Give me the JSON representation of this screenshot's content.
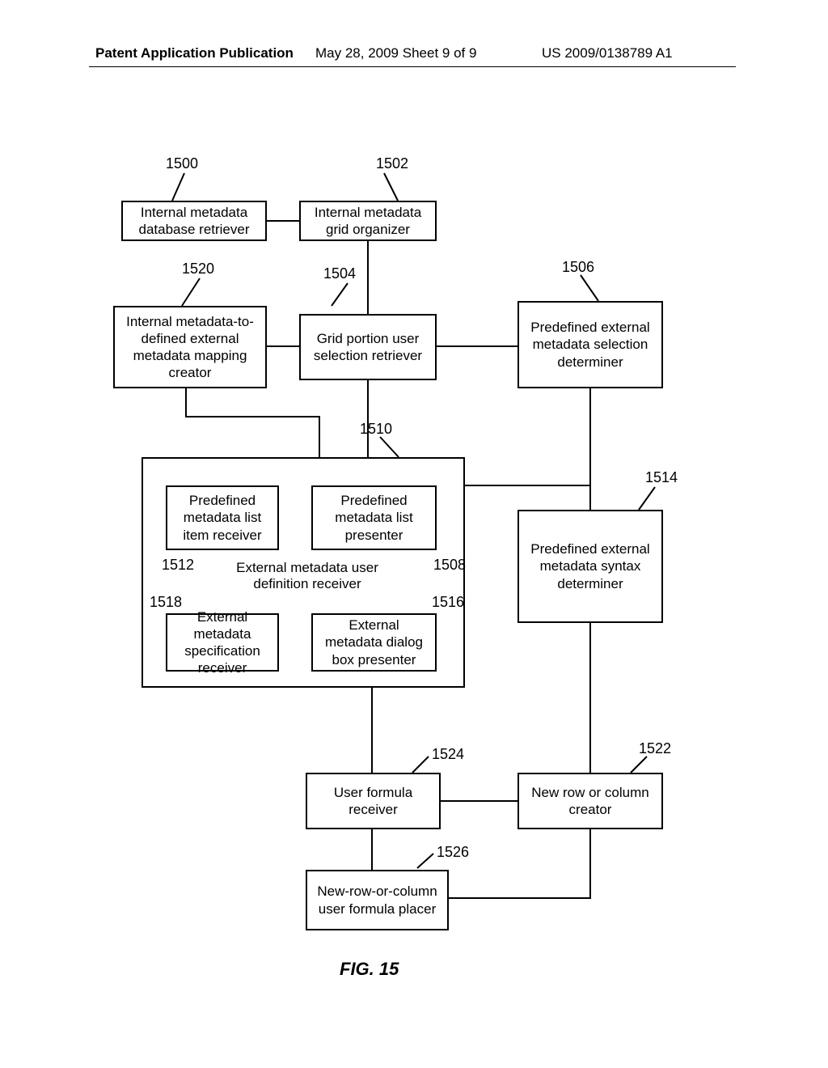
{
  "header": {
    "left": "Patent Application Publication",
    "center": "May 28, 2009  Sheet 9 of 9",
    "right": "US 2009/0138789 A1"
  },
  "boxes": {
    "b1500": "Internal metadata database retriever",
    "b1502": "Internal metadata grid organizer",
    "b1520": "Internal metadata-to-defined external metadata mapping creator",
    "b1504": "Grid portion user selection retriever",
    "b1506": "Predefined external metadata selection determiner",
    "b1512": "Predefined metadata list item receiver",
    "b1508": "Predefined metadata list presenter",
    "b1510_caption": "External metadata user definition receiver",
    "b1518": "External metadata specification receiver",
    "b1516": "External metadata dialog box presenter",
    "b1514": "Predefined external metadata syntax determiner",
    "b1524": "User formula receiver",
    "b1522": "New row or column creator",
    "b1526": "New-row-or-column user formula placer"
  },
  "labels": {
    "n1500": "1500",
    "n1502": "1502",
    "n1520": "1520",
    "n1504": "1504",
    "n1506": "1506",
    "n1510": "1510",
    "n1512": "1512",
    "n1508": "1508",
    "n1518": "1518",
    "n1516": "1516",
    "n1514": "1514",
    "n1524": "1524",
    "n1522": "1522",
    "n1526": "1526"
  },
  "figure_caption": "FIG. 15"
}
